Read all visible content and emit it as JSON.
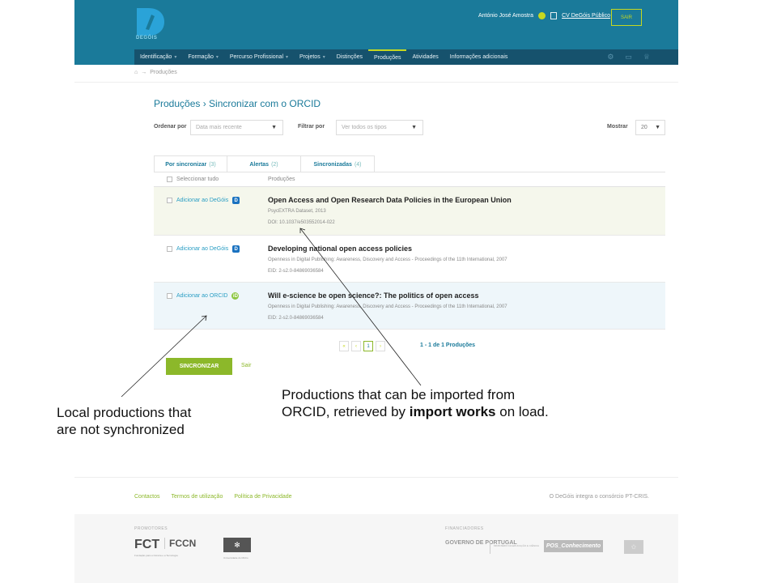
{
  "header": {
    "logo_text": "DEGÓIS",
    "user_name": "António José Amostra",
    "cv_link": "CV DeGóis Público",
    "logout_label": "SAIR",
    "nav": [
      {
        "label": "Identificação",
        "caret": true
      },
      {
        "label": "Formação",
        "caret": true
      },
      {
        "label": "Percurso Profissional",
        "caret": true
      },
      {
        "label": "Projetos",
        "caret": true
      },
      {
        "label": "Distinções",
        "caret": false
      },
      {
        "label": "Produções",
        "caret": false,
        "active": true
      },
      {
        "label": "Atividades",
        "caret": false
      },
      {
        "label": "Informações adicionais",
        "caret": false
      }
    ]
  },
  "breadcrumb": {
    "home_icon": "home-icon",
    "arrow": "→",
    "current": "Produções"
  },
  "page": {
    "title": "Produções › Sincronizar com o ORCID"
  },
  "filters": {
    "order_label": "Ordenar por",
    "order_value": "Data mais recente",
    "filter_label": "Filtrar por",
    "filter_value": "Ver todos os tipos",
    "show_label": "Mostrar",
    "show_value": "20"
  },
  "tabs": [
    {
      "label": "Por sincronizar",
      "count": "(3)"
    },
    {
      "label": "Alertas",
      "count": "(2)"
    },
    {
      "label": "Sincronizadas",
      "count": "(4)"
    }
  ],
  "table": {
    "select_all": "Seleccionar tudo",
    "col_productions": "Produções",
    "rows": [
      {
        "action": "Adicionar ao DeGóis",
        "badge": "degois",
        "title": "Open Access and Open Research Data Policies in the European Union",
        "source": "PsycEXTRA Dataset, 2013",
        "id": "DOI: 10.1037/e503552014-022"
      },
      {
        "action": "Adicionar ao DeGóis",
        "badge": "degois",
        "title": "Developing national open access policies",
        "source": "Openness in Digital Publishing: Awareness, Discovery and Access - Proceedings of the 11th International, 2007",
        "id": "EID: 2-s2.0-84869036584"
      },
      {
        "action": "Adicionar ao ORCID",
        "badge": "orcid",
        "title": "Will e-science be open science?: The politics of open access",
        "source": "Openness in Digital Publishing: Awareness, Discovery and Access - Proceedings of the 11th International, 2007",
        "id": "EID: 2-s2.0-84869036584"
      }
    ]
  },
  "pager": {
    "first": "«",
    "prev": "‹",
    "current": "1",
    "next": "›",
    "info": "1 - 1 de 1 Produções"
  },
  "actions": {
    "sync": "SINCRONIZAR",
    "exit": "Sair"
  },
  "annotations": {
    "left_line1": "Local productions that",
    "left_line2": "are not synchronized",
    "right_line1": "Productions that can be imported from",
    "right_line2_a": "ORCID, retrieved by ",
    "right_line2_b": "import works",
    "right_line2_c": " on load."
  },
  "footer": {
    "links": [
      "Contactos",
      "Termos de utilização",
      "Política de Privacidade"
    ],
    "consortium": "O DeGóis integra o consórcio PT-CRIS.",
    "promoters_label": "PROMOTORES",
    "funders_label": "FINANCIADORES",
    "fct": "FCT",
    "fct_sub": "Fundação para a Ciência e a Tecnologia",
    "fccn": "FCCN",
    "minho_sub": "Universidade do Minho",
    "gov": "GOVERNO DE PORTUGAL",
    "gov_sub": "MINISTÉRIO DA EDUCAÇÃO E CIÊNCIA",
    "poc": "POS_Conhecimento"
  },
  "colors": {
    "primary": "#1a7a9a",
    "accent": "#8cb82a",
    "lime": "#c6d820"
  }
}
